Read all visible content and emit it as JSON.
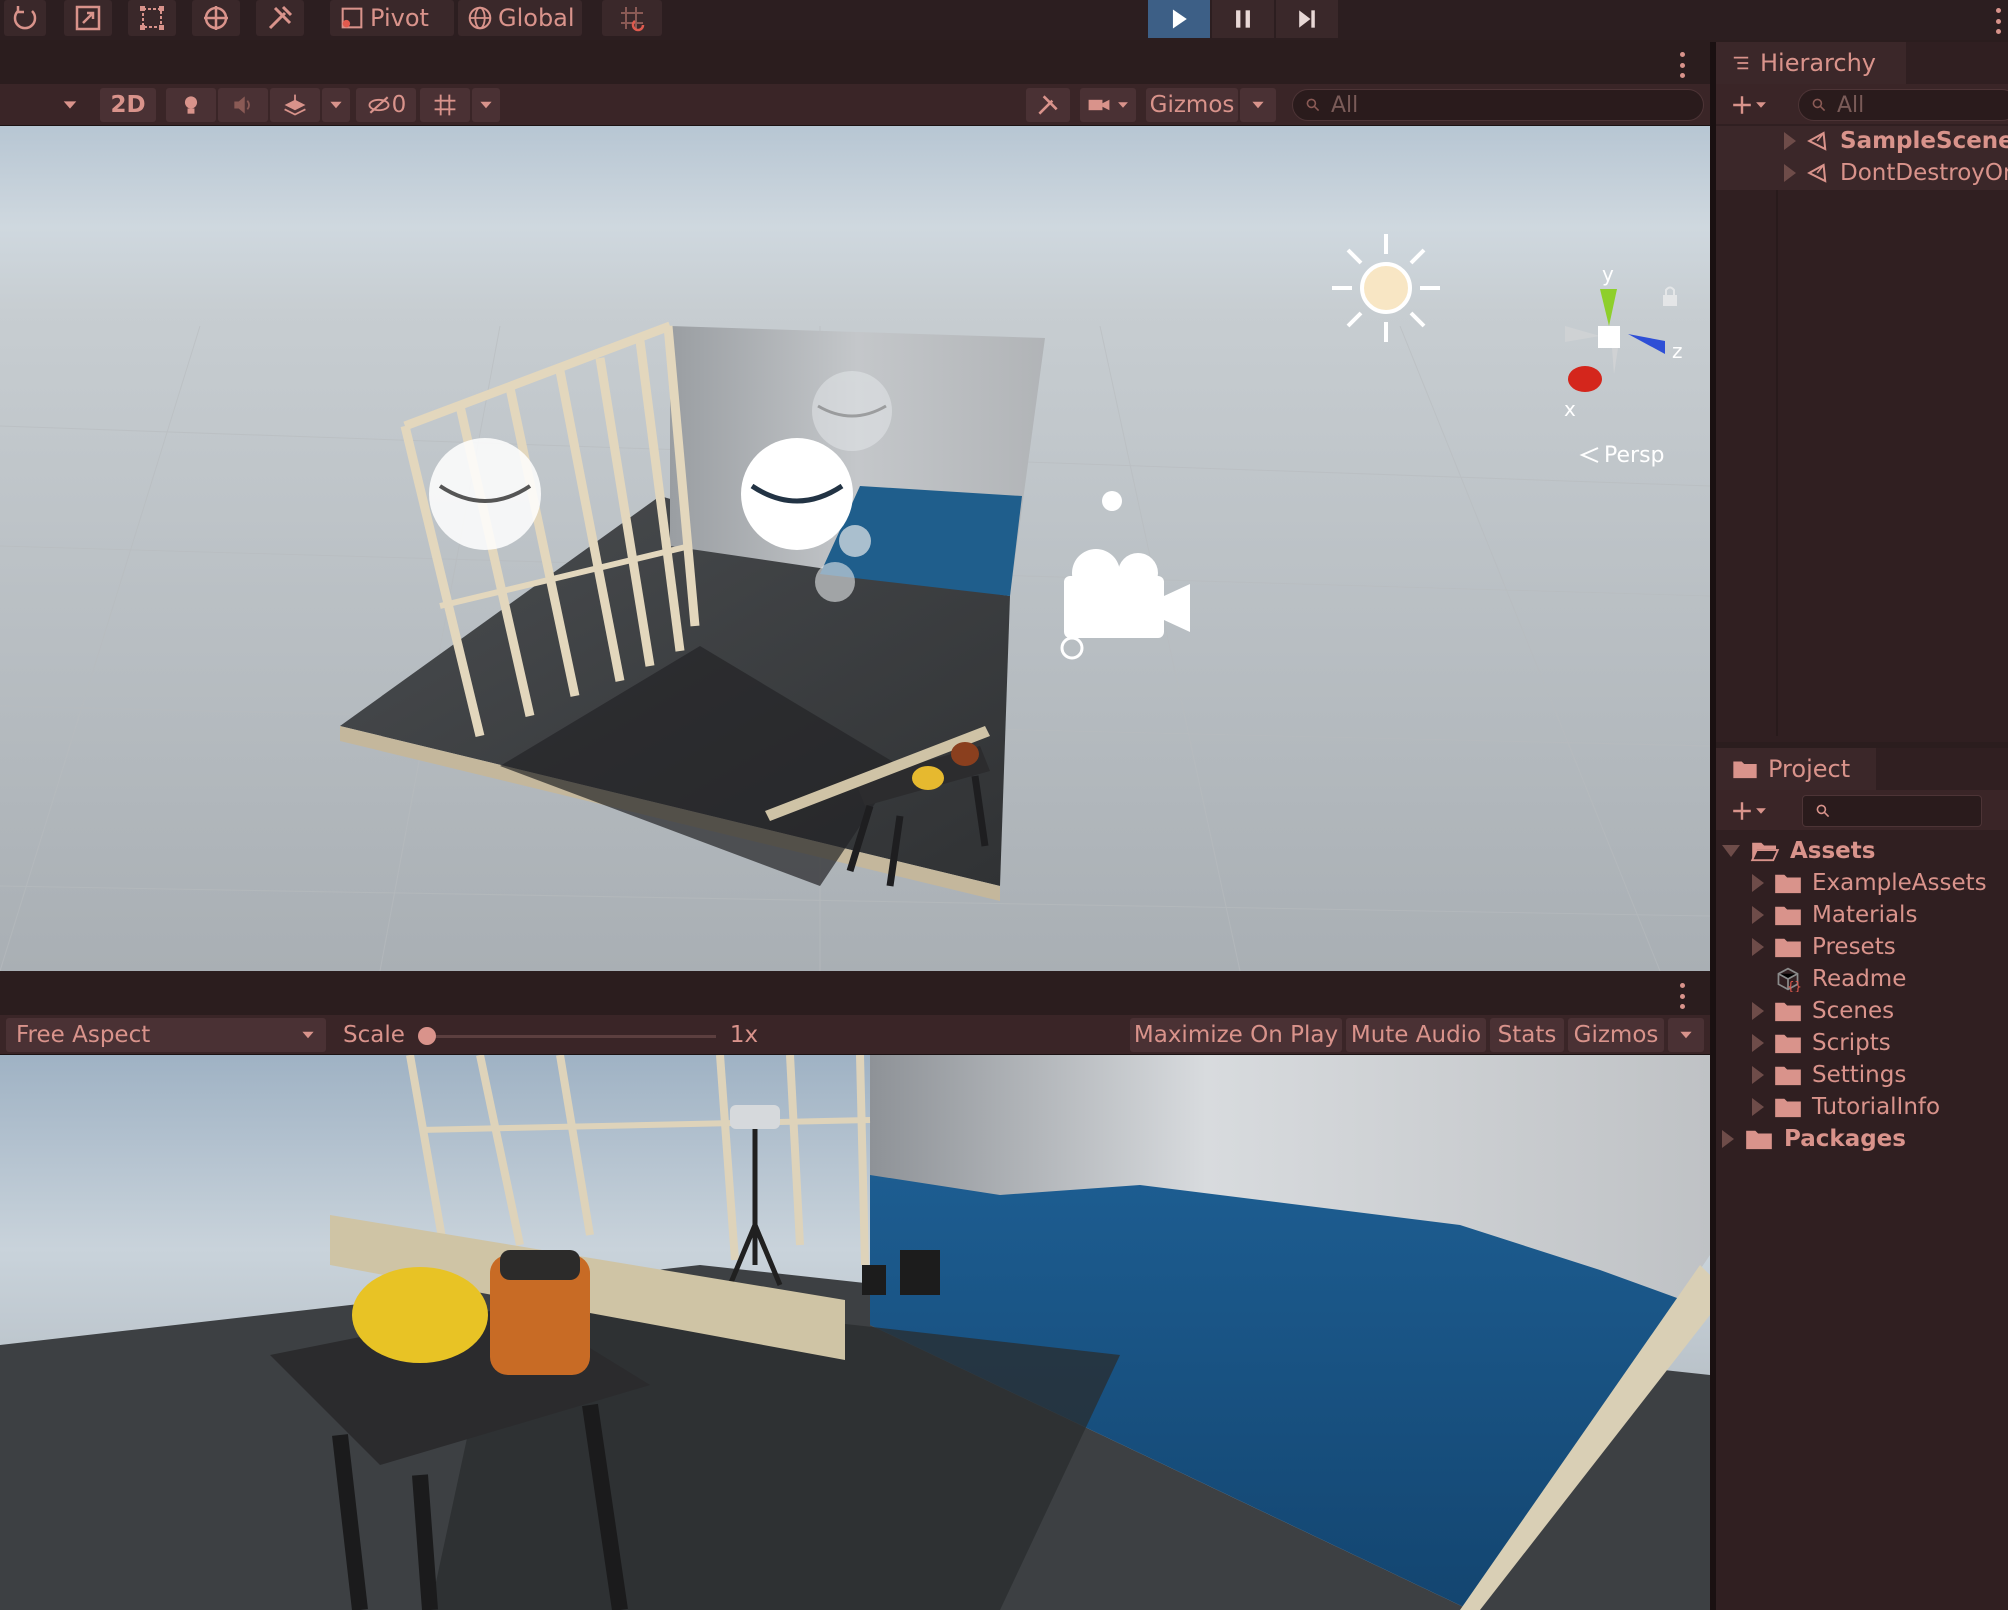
{
  "toolbar": {
    "pivot_label": "Pivot",
    "global_label": "Global"
  },
  "scene": {
    "toolbar": {
      "mode_2d": "2D",
      "hidden_count": "0",
      "gizmos_label": "Gizmos",
      "search_placeholder": "All"
    },
    "gizmo": {
      "axis_x": "x",
      "axis_y": "y",
      "axis_z": "z",
      "projection_label": "Persp"
    }
  },
  "game": {
    "toolbar": {
      "aspect": "Free Aspect",
      "scale_label": "Scale",
      "scale_value": "1x",
      "maximize_on_play": "Maximize On Play",
      "mute_audio": "Mute Audio",
      "stats": "Stats",
      "gizmos": "Gizmos"
    }
  },
  "hierarchy": {
    "tab_label": "Hierarchy",
    "search_placeholder": "All",
    "items": [
      {
        "label": "SampleScene"
      },
      {
        "label": "DontDestroyOn"
      }
    ]
  },
  "project": {
    "tab_label": "Project",
    "root": "Assets",
    "children": [
      {
        "label": "ExampleAssets",
        "type": "folder"
      },
      {
        "label": "Materials",
        "type": "folder"
      },
      {
        "label": "Presets",
        "type": "folder"
      },
      {
        "label": "Readme",
        "type": "asset"
      },
      {
        "label": "Scenes",
        "type": "folder"
      },
      {
        "label": "Scripts",
        "type": "folder"
      },
      {
        "label": "Settings",
        "type": "folder"
      },
      {
        "label": "TutorialInfo",
        "type": "folder"
      }
    ],
    "packages": "Packages"
  },
  "colors": {
    "accent_play": "#3d5f86",
    "text": "#d9938b",
    "panel_bg": "#301f21"
  }
}
